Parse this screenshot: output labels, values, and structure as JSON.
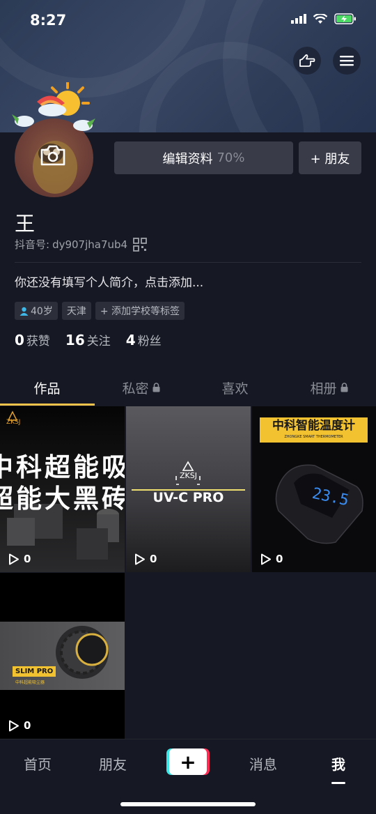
{
  "status": {
    "time": "8:27"
  },
  "profile": {
    "name": "王",
    "douyin_id_label": "抖音号:",
    "douyin_id": "dy907jha7ub4",
    "bio": "你还没有填写个人简介，点击添加...",
    "edit_label": "编辑资料",
    "edit_percent": "70%",
    "add_friend_label": "+ 朋友",
    "tags": [
      "40岁",
      "天津",
      "+ 添加学校等标签"
    ],
    "stats": [
      {
        "value": "0",
        "label": "获赞"
      },
      {
        "value": "16",
        "label": "关注"
      },
      {
        "value": "4",
        "label": "粉丝"
      }
    ]
  },
  "tabs": [
    {
      "label": "作品",
      "locked": false
    },
    {
      "label": "私密",
      "locked": true
    },
    {
      "label": "喜欢",
      "locked": false
    },
    {
      "label": "相册",
      "locked": true
    }
  ],
  "videos": [
    {
      "plays": "0",
      "text_line1": "中科超能吸",
      "text_line2": "超能大黑砖",
      "brand": "ZKSJ"
    },
    {
      "plays": "0",
      "brand": "ZKSJ",
      "product": "UV-C PRO"
    },
    {
      "plays": "0",
      "banner": "中科智能温度计",
      "banner_sub": "ZHONGKE SMART THERMOMETER",
      "display": "23.5"
    },
    {
      "plays": "0",
      "product": "SLIM PRO",
      "product_sub": "中科超能吸尘器"
    }
  ],
  "bottom_nav": [
    "首页",
    "朋友",
    "+",
    "消息",
    "我"
  ],
  "colors": {
    "accent": "#f5c24a",
    "background": "#161823",
    "button": "#393b48"
  }
}
